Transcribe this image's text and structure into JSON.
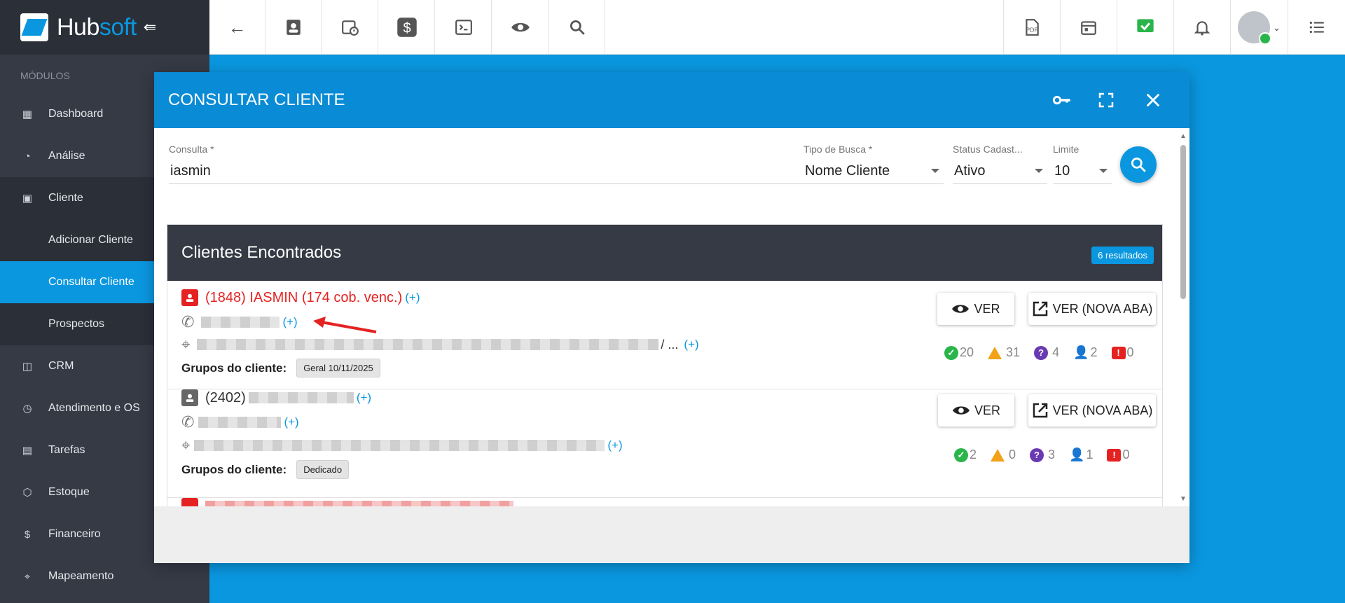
{
  "brand": {
    "name_part1": "Hub",
    "name_part2": "soft"
  },
  "sidebar": {
    "section_label": "MÓDULOS",
    "items": [
      {
        "label": "Dashboard"
      },
      {
        "label": "Análise"
      },
      {
        "label": "Cliente"
      },
      {
        "label": "Adicionar Cliente"
      },
      {
        "label": "Consultar Cliente"
      },
      {
        "label": "Prospectos"
      },
      {
        "label": "CRM"
      },
      {
        "label": "Atendimento e OS"
      },
      {
        "label": "Tarefas"
      },
      {
        "label": "Estoque"
      },
      {
        "label": "Financeiro"
      },
      {
        "label": "Mapeamento"
      }
    ]
  },
  "modal": {
    "title": "CONSULTAR CLIENTE",
    "fields": {
      "consulta": {
        "label": "Consulta *",
        "value": "iasmin"
      },
      "tipo": {
        "label": "Tipo de Busca *",
        "value": "Nome Cliente"
      },
      "status": {
        "label": "Status Cadast...",
        "value": "Ativo"
      },
      "limite": {
        "label": "Limite",
        "value": "10"
      }
    },
    "results": {
      "title": "Clientes Encontrados",
      "count_badge": "6 resultados",
      "rows": [
        {
          "name": "(1848) IASMIN (174 cob. venc.)",
          "plus": "(+)",
          "address_suffix": "/ ...",
          "groups_label": "Grupos do cliente:",
          "group": "Geral 10/11/2025",
          "stats": {
            "ok": "20",
            "warn": "31",
            "question": "4",
            "users": "2",
            "alert": "0"
          }
        },
        {
          "name": "(2402)",
          "plus": "(+)",
          "address_suffix": "",
          "groups_label": "Grupos do cliente:",
          "group": "Dedicado",
          "stats": {
            "ok": "2",
            "warn": "0",
            "question": "3",
            "users": "1",
            "alert": "0"
          }
        }
      ],
      "btn_view": "VER",
      "btn_view_new_tab": "VER (NOVA ABA)"
    }
  },
  "colors": {
    "accent": "#0a97e0",
    "sidebar": "#353a45",
    "danger": "#e52222",
    "success": "#2ab54b",
    "warning": "#f2a218",
    "purple": "#6a3ab2"
  }
}
